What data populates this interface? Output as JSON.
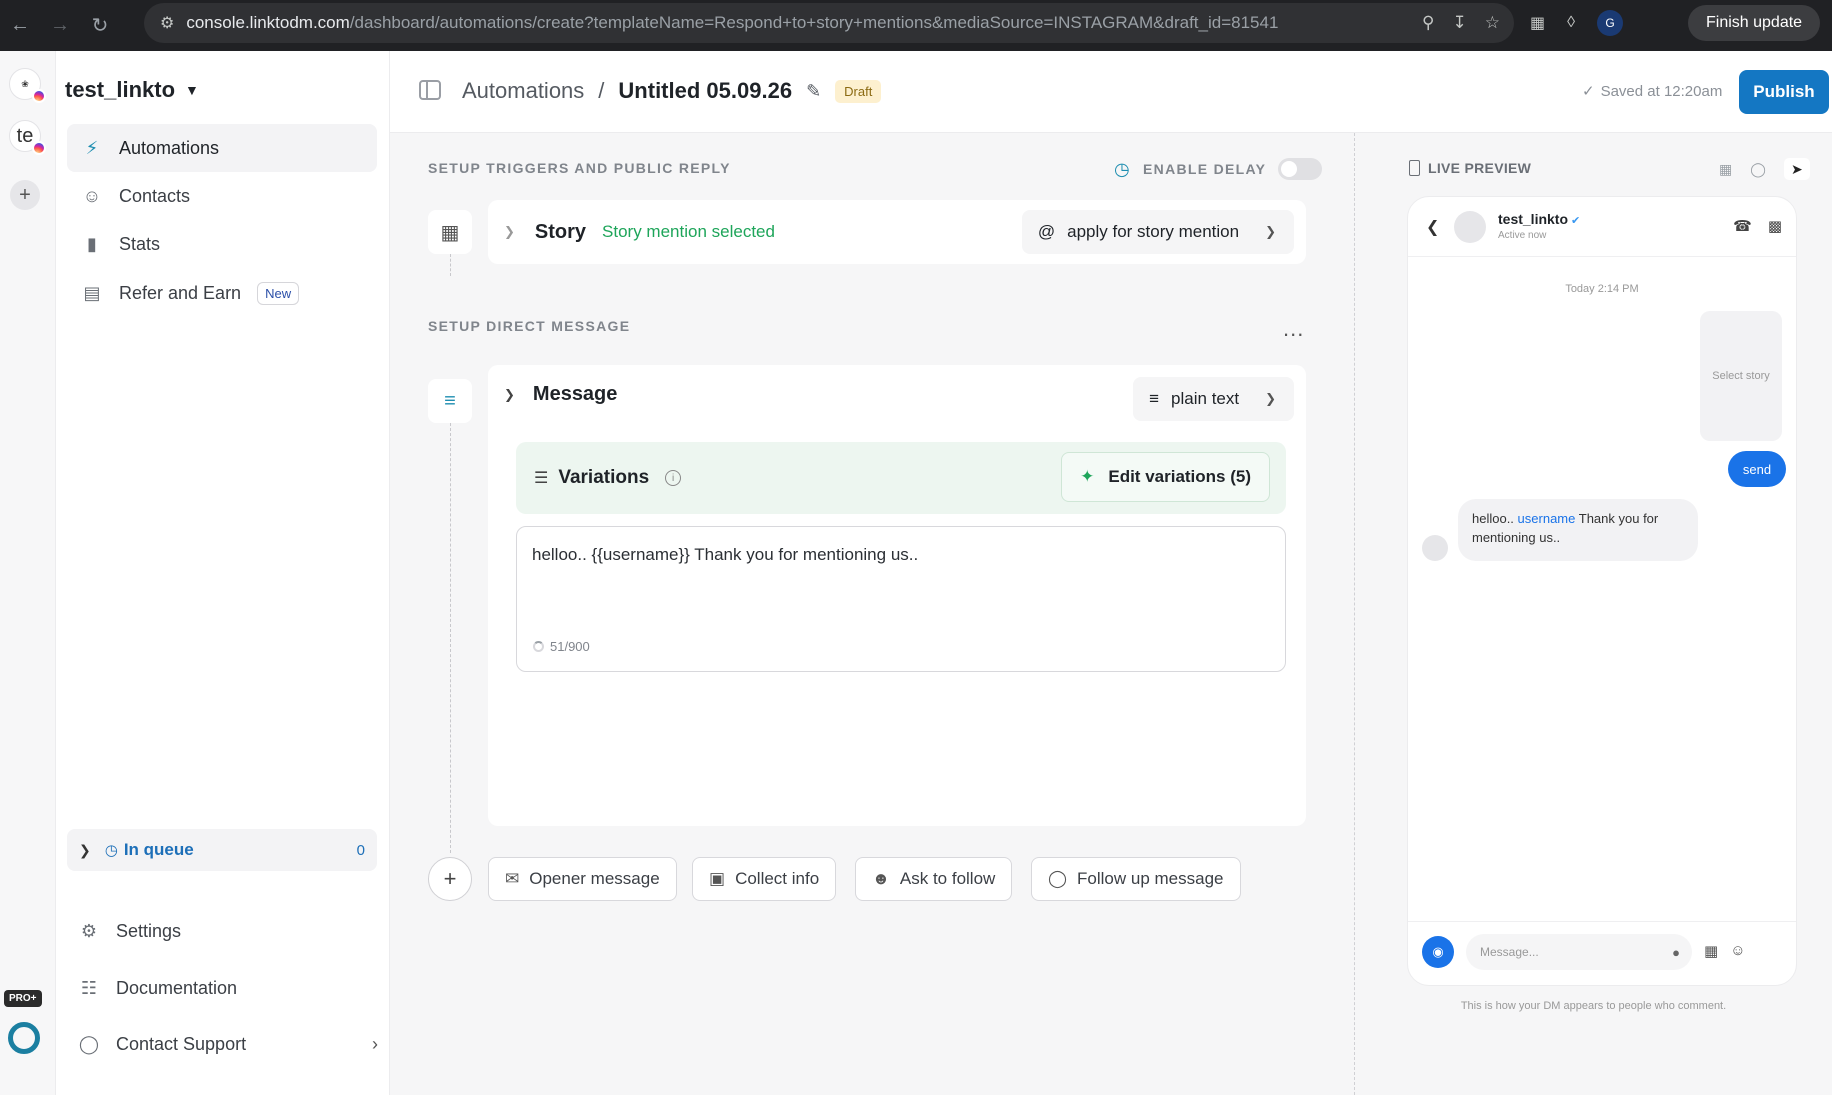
{
  "browser": {
    "url_host": "console.linktodm.com",
    "url_path": "/dashboard/automations/create?templateName=Respond+to+story+mentions&mediaSource=INSTAGRAM&draft_id=81541",
    "profile_initial": "G",
    "finish_update": "Finish update"
  },
  "rail": {
    "account2_initial": "te",
    "pro_label": "PRO+"
  },
  "sidebar": {
    "workspace": "test_linkto",
    "items": [
      {
        "label": "Automations"
      },
      {
        "label": "Contacts"
      },
      {
        "label": "Stats"
      },
      {
        "label": "Refer and Earn",
        "badge": "New"
      }
    ],
    "queue": {
      "label": "In queue",
      "count": "0"
    },
    "bottom": [
      {
        "label": "Settings"
      },
      {
        "label": "Documentation"
      },
      {
        "label": "Contact Support"
      }
    ]
  },
  "header": {
    "root": "Automations",
    "separator": "/",
    "title": "Untitled 05.09.26",
    "status": "Draft",
    "saved": "Saved at 12:20am",
    "publish": "Publish"
  },
  "triggers": {
    "section_label": "SETUP TRIGGERS AND PUBLIC REPLY",
    "delay_label": "ENABLE DELAY",
    "story_name": "Story",
    "story_status": "Story mention selected",
    "story_select": "apply for story mention"
  },
  "dm": {
    "section_label": "SETUP DIRECT MESSAGE",
    "more": "...",
    "message_title": "Message",
    "format_select": "plain text",
    "variations_label": "Variations",
    "edit_variations": "Edit variations (5)",
    "message_text": "helloo.. {{username}} Thank you for mentioning us..",
    "counter": "51/900"
  },
  "steps": [
    {
      "label": "Opener message",
      "icon": "mail-icon"
    },
    {
      "label": "Collect info",
      "icon": "inbox-icon"
    },
    {
      "label": "Ask to follow",
      "icon": "user-plus-icon"
    },
    {
      "label": "Follow up message",
      "icon": "chat-bubble-icon"
    }
  ],
  "preview": {
    "label": "LIVE PREVIEW",
    "contact_name": "test_linkto",
    "contact_status": "Active now",
    "time": "Today 2:14 PM",
    "story_placeholder": "Select story",
    "send": "send",
    "reply_prefix": "helloo..",
    "reply_username": "username",
    "reply_suffix": "Thank you for mentioning us..",
    "input_placeholder": "Message...",
    "footer": "This is how your DM appears to people who comment."
  },
  "colors": {
    "accent": "#1477c3",
    "success": "#1ea55a",
    "draft_bg": "#fdf0cf"
  }
}
